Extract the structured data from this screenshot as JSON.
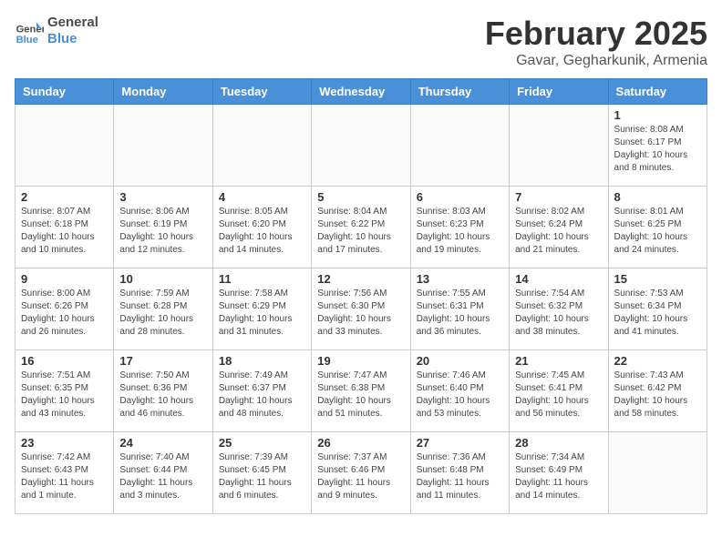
{
  "header": {
    "logo_line1": "General",
    "logo_line2": "Blue",
    "month": "February 2025",
    "location": "Gavar, Gegharkunik, Armenia"
  },
  "weekdays": [
    "Sunday",
    "Monday",
    "Tuesday",
    "Wednesday",
    "Thursday",
    "Friday",
    "Saturday"
  ],
  "weeks": [
    [
      {
        "day": "",
        "info": ""
      },
      {
        "day": "",
        "info": ""
      },
      {
        "day": "",
        "info": ""
      },
      {
        "day": "",
        "info": ""
      },
      {
        "day": "",
        "info": ""
      },
      {
        "day": "",
        "info": ""
      },
      {
        "day": "1",
        "info": "Sunrise: 8:08 AM\nSunset: 6:17 PM\nDaylight: 10 hours and 8 minutes."
      }
    ],
    [
      {
        "day": "2",
        "info": "Sunrise: 8:07 AM\nSunset: 6:18 PM\nDaylight: 10 hours and 10 minutes."
      },
      {
        "day": "3",
        "info": "Sunrise: 8:06 AM\nSunset: 6:19 PM\nDaylight: 10 hours and 12 minutes."
      },
      {
        "day": "4",
        "info": "Sunrise: 8:05 AM\nSunset: 6:20 PM\nDaylight: 10 hours and 14 minutes."
      },
      {
        "day": "5",
        "info": "Sunrise: 8:04 AM\nSunset: 6:22 PM\nDaylight: 10 hours and 17 minutes."
      },
      {
        "day": "6",
        "info": "Sunrise: 8:03 AM\nSunset: 6:23 PM\nDaylight: 10 hours and 19 minutes."
      },
      {
        "day": "7",
        "info": "Sunrise: 8:02 AM\nSunset: 6:24 PM\nDaylight: 10 hours and 21 minutes."
      },
      {
        "day": "8",
        "info": "Sunrise: 8:01 AM\nSunset: 6:25 PM\nDaylight: 10 hours and 24 minutes."
      }
    ],
    [
      {
        "day": "9",
        "info": "Sunrise: 8:00 AM\nSunset: 6:26 PM\nDaylight: 10 hours and 26 minutes."
      },
      {
        "day": "10",
        "info": "Sunrise: 7:59 AM\nSunset: 6:28 PM\nDaylight: 10 hours and 28 minutes."
      },
      {
        "day": "11",
        "info": "Sunrise: 7:58 AM\nSunset: 6:29 PM\nDaylight: 10 hours and 31 minutes."
      },
      {
        "day": "12",
        "info": "Sunrise: 7:56 AM\nSunset: 6:30 PM\nDaylight: 10 hours and 33 minutes."
      },
      {
        "day": "13",
        "info": "Sunrise: 7:55 AM\nSunset: 6:31 PM\nDaylight: 10 hours and 36 minutes."
      },
      {
        "day": "14",
        "info": "Sunrise: 7:54 AM\nSunset: 6:32 PM\nDaylight: 10 hours and 38 minutes."
      },
      {
        "day": "15",
        "info": "Sunrise: 7:53 AM\nSunset: 6:34 PM\nDaylight: 10 hours and 41 minutes."
      }
    ],
    [
      {
        "day": "16",
        "info": "Sunrise: 7:51 AM\nSunset: 6:35 PM\nDaylight: 10 hours and 43 minutes."
      },
      {
        "day": "17",
        "info": "Sunrise: 7:50 AM\nSunset: 6:36 PM\nDaylight: 10 hours and 46 minutes."
      },
      {
        "day": "18",
        "info": "Sunrise: 7:49 AM\nSunset: 6:37 PM\nDaylight: 10 hours and 48 minutes."
      },
      {
        "day": "19",
        "info": "Sunrise: 7:47 AM\nSunset: 6:38 PM\nDaylight: 10 hours and 51 minutes."
      },
      {
        "day": "20",
        "info": "Sunrise: 7:46 AM\nSunset: 6:40 PM\nDaylight: 10 hours and 53 minutes."
      },
      {
        "day": "21",
        "info": "Sunrise: 7:45 AM\nSunset: 6:41 PM\nDaylight: 10 hours and 56 minutes."
      },
      {
        "day": "22",
        "info": "Sunrise: 7:43 AM\nSunset: 6:42 PM\nDaylight: 10 hours and 58 minutes."
      }
    ],
    [
      {
        "day": "23",
        "info": "Sunrise: 7:42 AM\nSunset: 6:43 PM\nDaylight: 11 hours and 1 minute."
      },
      {
        "day": "24",
        "info": "Sunrise: 7:40 AM\nSunset: 6:44 PM\nDaylight: 11 hours and 3 minutes."
      },
      {
        "day": "25",
        "info": "Sunrise: 7:39 AM\nSunset: 6:45 PM\nDaylight: 11 hours and 6 minutes."
      },
      {
        "day": "26",
        "info": "Sunrise: 7:37 AM\nSunset: 6:46 PM\nDaylight: 11 hours and 9 minutes."
      },
      {
        "day": "27",
        "info": "Sunrise: 7:36 AM\nSunset: 6:48 PM\nDaylight: 11 hours and 11 minutes."
      },
      {
        "day": "28",
        "info": "Sunrise: 7:34 AM\nSunset: 6:49 PM\nDaylight: 11 hours and 14 minutes."
      },
      {
        "day": "",
        "info": ""
      }
    ]
  ]
}
